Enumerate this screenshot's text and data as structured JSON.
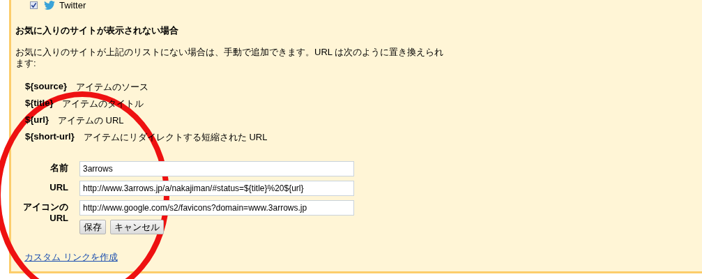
{
  "sites": [
    {
      "label": "Twitter",
      "checked": true
    }
  ],
  "heading": "お気に入りのサイトが表示されない場合",
  "description": "お気に入りのサイトが上記のリストにない場合は、手動で追加できます。URL は次のように置き換えられます:",
  "variables": [
    {
      "token": "${source}",
      "meaning": "アイテムのソース"
    },
    {
      "token": "${title}",
      "meaning": "アイテムのタイトル"
    },
    {
      "token": "${url}",
      "meaning": "アイテムの URL"
    },
    {
      "token": "${short-url}",
      "meaning": "アイテムにリダイレクトする短縮された URL"
    }
  ],
  "form": {
    "fields": [
      {
        "label": "名前",
        "value": "3arrows"
      },
      {
        "label": "URL",
        "value": "http://www.3arrows.jp/a/nakajiman/#status=${title}%20${url}"
      },
      {
        "label": "アイコンの URL",
        "value": "http://www.google.com/s2/favicons?domain=www.3arrows.jp"
      }
    ],
    "buttons": [
      "保存",
      "キャンセル"
    ]
  },
  "link": "カスタム リンクを作成"
}
